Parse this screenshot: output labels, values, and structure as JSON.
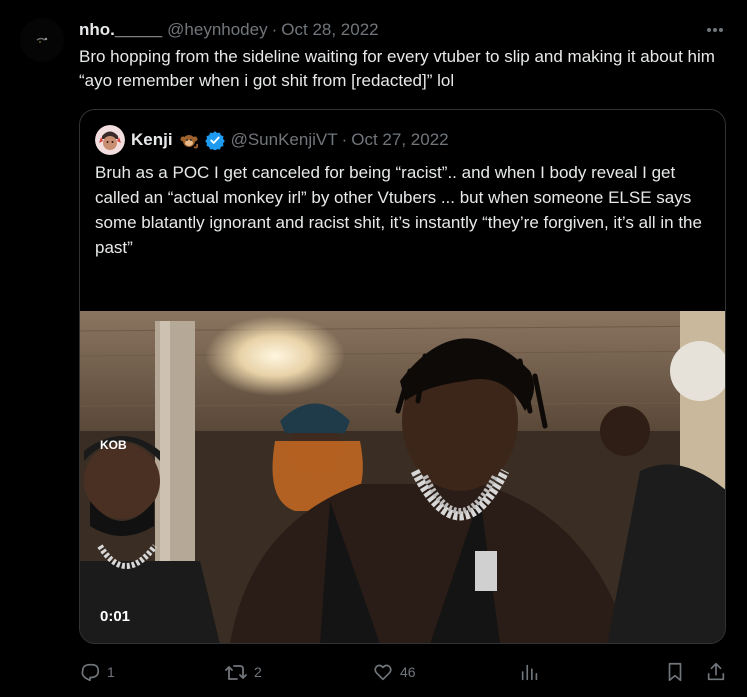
{
  "tweet": {
    "display_name": "nho._____",
    "handle": "@heynhodey",
    "separator": "·",
    "date": "Oct 28, 2022",
    "more_icon": "more-horizontal-icon",
    "text": "Bro hopping from the sideline waiting for every vtuber to slip and making it about him “ayo remember when i got shit from [redacted]” lol"
  },
  "quoted_tweet": {
    "display_name": "Kenji",
    "emoji": "monkey-emoji",
    "verified_icon": "verified-badge-icon",
    "handle": "@SunKenjiVT",
    "separator": "·",
    "date": "Oct 27, 2022",
    "text": "Bruh as a POC I get canceled for being “racist”.. and when I body reveal I get called an “actual monkey irl” by other Vtubers ... but when someone ELSE says some blatantly ignorant and racist shit, it’s instantly “they’re forgiven, it’s all in the past”",
    "video_time": "0:01"
  },
  "actions": {
    "reply_count": "1",
    "retweet_count": "2",
    "like_count": "46",
    "views_icon": "analytics-icon",
    "bookmark_icon": "bookmark-icon",
    "share_icon": "share-icon"
  },
  "colors": {
    "background": "#000000",
    "text": "#e7e9ea",
    "muted": "#71767b",
    "border": "#2f3336",
    "verified": "#1d9bf0"
  }
}
